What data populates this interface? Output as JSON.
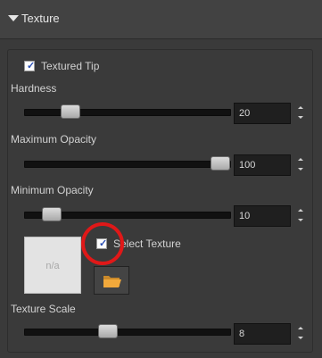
{
  "section": {
    "title": "Texture",
    "toggle_icon": "triangle-down-icon"
  },
  "textured_tip": {
    "label": "Textured Tip",
    "checked": true
  },
  "hardness": {
    "label": "Hardness",
    "value": "20",
    "slider_fraction": 0.2
  },
  "maximum_opacity": {
    "label": "Maximum Opacity",
    "value": "100",
    "slider_fraction": 1.0
  },
  "minimum_opacity": {
    "label": "Minimum Opacity",
    "value": "10",
    "slider_fraction": 0.1
  },
  "select_texture": {
    "label": "Select Texture",
    "checked": true,
    "preview_text": "n/a",
    "browse_icon": "folder-icon"
  },
  "texture_scale": {
    "label": "Texture Scale",
    "value": "8"
  },
  "colors": {
    "background": "#3a3a3a",
    "highlight_ring": "#e01818",
    "checkmark": "#2a4fb5",
    "folder": "#f2a93b"
  }
}
